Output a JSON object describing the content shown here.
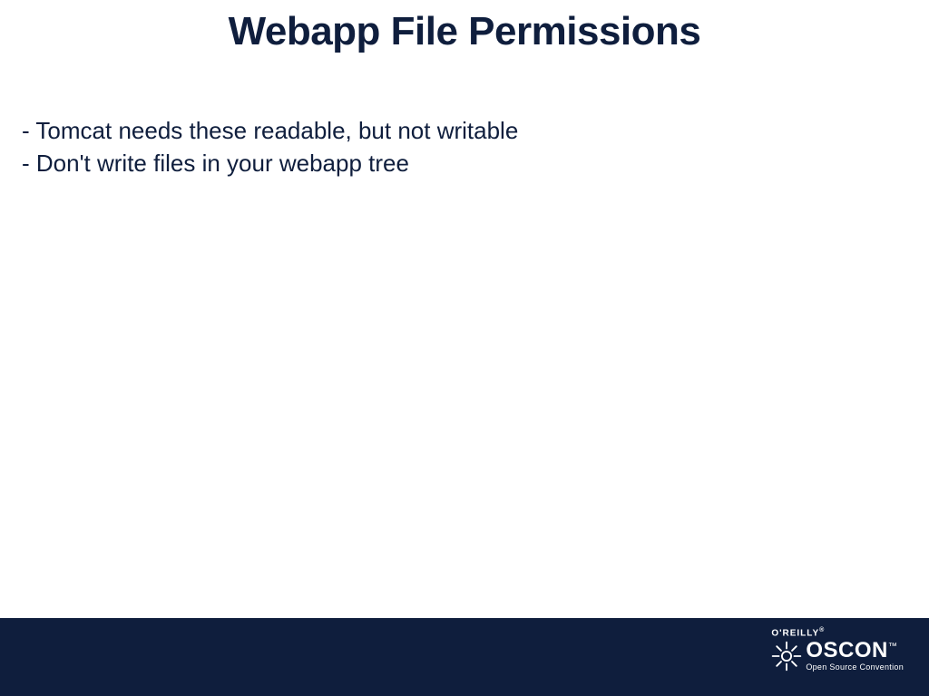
{
  "title": "Webapp File Permissions",
  "bullets": [
    "- Tomcat needs these readable, but not writable",
    "- Don't write files in your webapp tree"
  ],
  "footer": {
    "brand": "O'REILLY",
    "conference": "OSCON",
    "tagline": "Open Source Convention"
  }
}
